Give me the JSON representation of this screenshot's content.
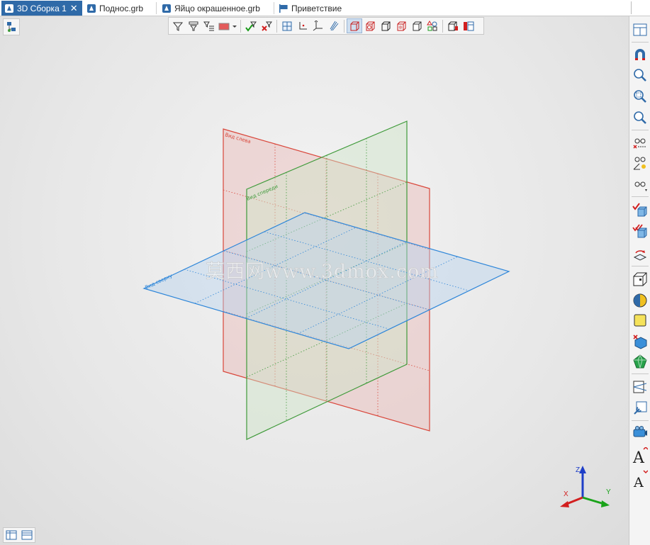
{
  "tabs": [
    {
      "label": "3D Сборка 1",
      "active": true,
      "closable": true,
      "icon": "assembly-icon"
    },
    {
      "label": "Поднос.grb",
      "active": false,
      "icon": "part-icon"
    },
    {
      "label": "Яйцо окрашенное.grb",
      "active": false,
      "icon": "part-icon"
    },
    {
      "label": "Приветствие",
      "active": false,
      "icon": "flag-icon"
    }
  ],
  "tab_close_glyph": "✕",
  "planes": {
    "left_view_label": "Вид слева",
    "front_view_label": "Вид спереди",
    "top_view_label": "Вид сверху"
  },
  "axes": {
    "x": "X",
    "y": "Y",
    "z": "Z"
  },
  "watermark": "莫西网www.3dmox.com",
  "colors": {
    "accent": "#2f6aa8",
    "plane_left": "#d9463a",
    "plane_front": "#3f9a3a",
    "plane_top": "#2e86d9",
    "axis_x": "#d21f1f",
    "axis_y": "#1aa31a",
    "axis_z": "#1f3fc8"
  },
  "top_toolbar_icons": [
    "filter-icon",
    "filter-select-icon",
    "filter-list-icon",
    "color-select-icon",
    "dropdown-icon",
    "check-filter-icon",
    "clear-filter-icon",
    "plane-xy-icon",
    "axis-2d-icon",
    "axis-3d-icon",
    "surface-icon",
    "box-wireframe-icon",
    "box-hidden-icon",
    "box-shaded-icon",
    "box-shaded-edges-icon",
    "box-outline-icon",
    "shapes-icon",
    "cube-red-icon",
    "panel-icon"
  ],
  "right_toolbar_icons": [
    "layout-icon",
    "magnet-icon",
    "zoom-icon",
    "zoom-window-icon",
    "zoom-fit-icon",
    "glasses-hide-icon",
    "glasses-measure-icon",
    "glasses-icon",
    "check-box-icon",
    "check-box-multi-icon",
    "rotate-plane-icon",
    "cube-outline-icon",
    "sphere-icon",
    "yellow-square-icon",
    "cube-delete-icon",
    "green-gem-icon",
    "projection-icon",
    "wrench-icon",
    "camera-icon",
    "font-up-icon",
    "font-icon"
  ]
}
